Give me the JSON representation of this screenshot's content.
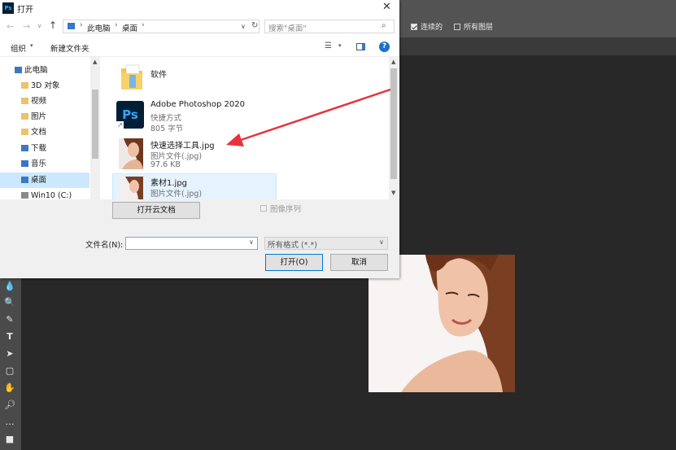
{
  "dialog": {
    "title": "打开",
    "app_badge": "Ps",
    "address": {
      "path": [
        "此电脑",
        "桌面"
      ],
      "search_placeholder": "搜索\"桌面\""
    },
    "toolbar": {
      "organize": "组织",
      "new_folder": "新建文件夹"
    },
    "nav_items": [
      {
        "label": "此电脑",
        "icon": "computer-icon"
      },
      {
        "label": "3D 对象",
        "icon": "folder-icon"
      },
      {
        "label": "视频",
        "icon": "folder-icon"
      },
      {
        "label": "图片",
        "icon": "folder-icon"
      },
      {
        "label": "文档",
        "icon": "folder-icon"
      },
      {
        "label": "下载",
        "icon": "download-icon"
      },
      {
        "label": "音乐",
        "icon": "music-icon"
      },
      {
        "label": "桌面",
        "icon": "folder-icon",
        "selected": true
      },
      {
        "label": "Win10 (C:)",
        "icon": "drive-icon"
      }
    ],
    "files": [
      {
        "name": "软件",
        "type": "",
        "size": "",
        "icon": "folder-icon"
      },
      {
        "name": "Adobe Photoshop 2020",
        "type": "快捷方式",
        "size": "805 字节",
        "icon": "photoshop-icon"
      },
      {
        "name": "快速选择工具.jpg",
        "type": "图片文件(.jpg)",
        "size": "97.6 KB",
        "icon": "image-thumbnail"
      },
      {
        "name": "素材1.jpg",
        "type": "图片文件(.jpg)",
        "size": "",
        "icon": "image-thumbnail",
        "selected": true
      }
    ],
    "cloud_button": "打开云文档",
    "image_sequence_label": "图像序列",
    "filename_label": "文件名(N):",
    "filename_value": "",
    "filter_value": "所有格式 (*.*)",
    "open_button": "打开(O)",
    "cancel_button": "取消"
  },
  "ps_options": {
    "continuous": "连续的",
    "all_layers": "所有图层"
  },
  "colors": {
    "accent": "#0078d7",
    "arrow": "#e8323c",
    "ps_bg": "#282828",
    "ps_blue": "#31a8ff"
  }
}
